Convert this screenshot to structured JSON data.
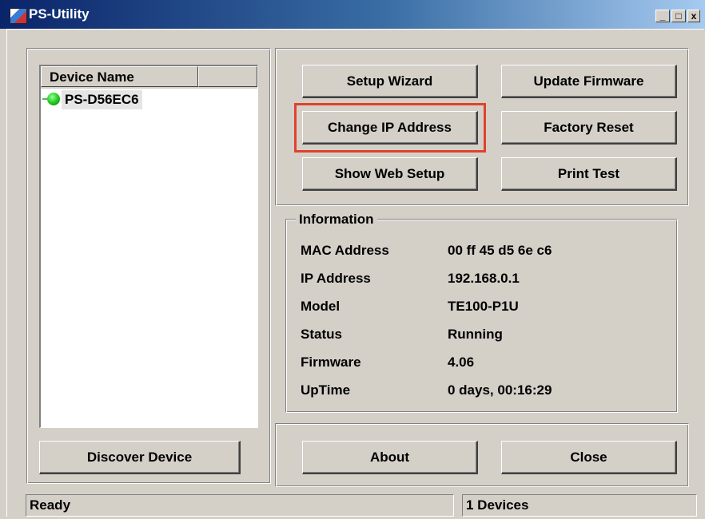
{
  "window": {
    "title": "PS-Utility",
    "minimize_glyph": "_",
    "maximize_glyph": "□",
    "close_glyph": "x"
  },
  "device_list": {
    "column_header": "Device Name",
    "items": [
      {
        "name": "PS-D56EC6",
        "status_color": "#22bb22"
      }
    ]
  },
  "actions": {
    "setup_wizard": "Setup Wizard",
    "update_firmware": "Update Firmware",
    "change_ip": "Change IP Address",
    "factory_reset": "Factory Reset",
    "show_web_setup": "Show Web Setup",
    "print_test": "Print Test"
  },
  "information": {
    "title": "Information",
    "rows": [
      {
        "label": "MAC Address",
        "value": "00 ff 45 d5 6e c6"
      },
      {
        "label": "IP Address",
        "value": "192.168.0.1"
      },
      {
        "label": "Model",
        "value": "TE100-P1U"
      },
      {
        "label": "Status",
        "value": "Running"
      },
      {
        "label": "Firmware",
        "value": "4.06"
      },
      {
        "label": "UpTime",
        "value": "0 days, 00:16:29"
      }
    ]
  },
  "bottom": {
    "discover": "Discover Device",
    "about": "About",
    "close": "Close"
  },
  "statusbar": {
    "left": "Ready",
    "right": "1 Devices"
  },
  "colors": {
    "highlight": "#e0412c",
    "face": "#d4d0c8"
  }
}
